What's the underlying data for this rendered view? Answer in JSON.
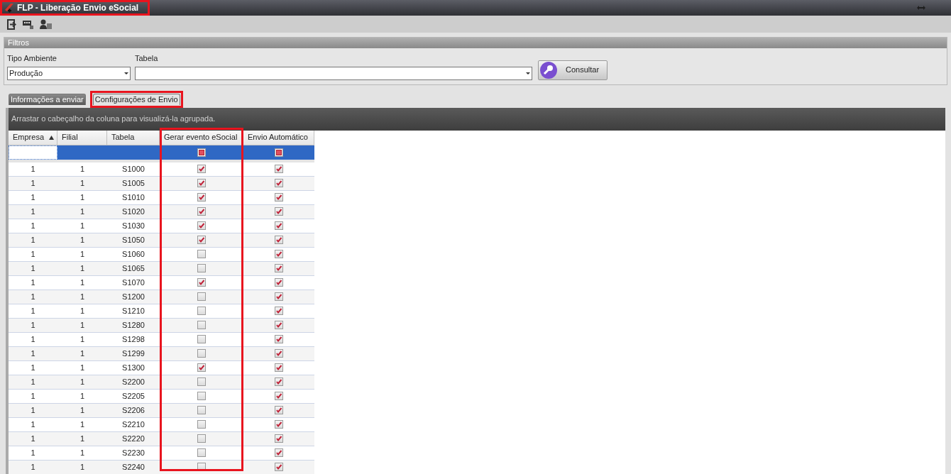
{
  "window": {
    "title": "FLP - Liberação Envio eSocial",
    "highlighted": true
  },
  "filters": {
    "title": "Filtros",
    "fields": [
      {
        "label": "Tipo Ambiente",
        "value": "Produção"
      },
      {
        "label": "Tabela"
      }
    ],
    "button": "Consultar"
  },
  "tabs": [
    {
      "label": "Informações a enviar",
      "selected": false,
      "highlighted": false
    },
    {
      "label": "Configurações de Envio",
      "selected": true,
      "highlighted": true
    }
  ],
  "group_hint": "Arrastar o cabeçalho da coluna para visualizá-la agrupada.",
  "columns": [
    {
      "label": "Empresa",
      "sorted": true,
      "highlighted": false
    },
    {
      "label": "Filial",
      "sorted": false,
      "highlighted": false
    },
    {
      "label": "Tabela",
      "sorted": false,
      "highlighted": false
    },
    {
      "label": "Gerar evento eSocial",
      "sorted": false,
      "highlighted": true
    },
    {
      "label": "Envio Automático",
      "sorted": false,
      "highlighted": false
    }
  ],
  "rows": [
    {
      "empresa": "1",
      "filial": "1",
      "tabela": "S1000",
      "gerar": true,
      "envio": true
    },
    {
      "empresa": "1",
      "filial": "1",
      "tabela": "S1005",
      "gerar": true,
      "envio": true
    },
    {
      "empresa": "1",
      "filial": "1",
      "tabela": "S1010",
      "gerar": true,
      "envio": true
    },
    {
      "empresa": "1",
      "filial": "1",
      "tabela": "S1020",
      "gerar": true,
      "envio": true
    },
    {
      "empresa": "1",
      "filial": "1",
      "tabela": "S1030",
      "gerar": true,
      "envio": true
    },
    {
      "empresa": "1",
      "filial": "1",
      "tabela": "S1050",
      "gerar": true,
      "envio": true
    },
    {
      "empresa": "1",
      "filial": "1",
      "tabela": "S1060",
      "gerar": false,
      "envio": true
    },
    {
      "empresa": "1",
      "filial": "1",
      "tabela": "S1065",
      "gerar": false,
      "envio": true
    },
    {
      "empresa": "1",
      "filial": "1",
      "tabela": "S1070",
      "gerar": true,
      "envio": true
    },
    {
      "empresa": "1",
      "filial": "1",
      "tabela": "S1200",
      "gerar": false,
      "envio": true
    },
    {
      "empresa": "1",
      "filial": "1",
      "tabela": "S1210",
      "gerar": false,
      "envio": true
    },
    {
      "empresa": "1",
      "filial": "1",
      "tabela": "S1280",
      "gerar": false,
      "envio": true
    },
    {
      "empresa": "1",
      "filial": "1",
      "tabela": "S1298",
      "gerar": false,
      "envio": true
    },
    {
      "empresa": "1",
      "filial": "1",
      "tabela": "S1299",
      "gerar": false,
      "envio": true
    },
    {
      "empresa": "1",
      "filial": "1",
      "tabela": "S1300",
      "gerar": true,
      "envio": true
    },
    {
      "empresa": "1",
      "filial": "1",
      "tabela": "S2200",
      "gerar": false,
      "envio": true
    },
    {
      "empresa": "1",
      "filial": "1",
      "tabela": "S2205",
      "gerar": false,
      "envio": true
    },
    {
      "empresa": "1",
      "filial": "1",
      "tabela": "S2206",
      "gerar": false,
      "envio": true
    },
    {
      "empresa": "1",
      "filial": "1",
      "tabela": "S2210",
      "gerar": false,
      "envio": true
    },
    {
      "empresa": "1",
      "filial": "1",
      "tabela": "S2220",
      "gerar": false,
      "envio": true
    },
    {
      "empresa": "1",
      "filial": "1",
      "tabela": "S2230",
      "gerar": false,
      "envio": true
    },
    {
      "empresa": "1",
      "filial": "1",
      "tabela": "S2240",
      "gerar": false,
      "envio": true
    }
  ]
}
